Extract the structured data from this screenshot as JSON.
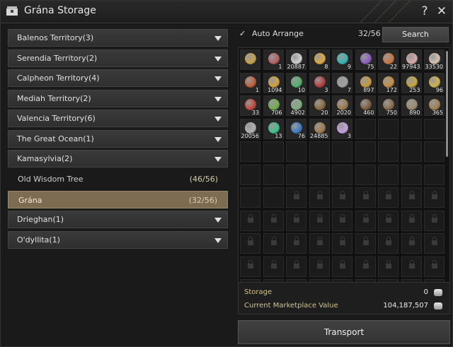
{
  "window": {
    "title": "Grána Storage"
  },
  "territories": [
    {
      "label": "Balenos Territory(3)"
    },
    {
      "label": "Serendia Territory(2)"
    },
    {
      "label": "Calpheon Territory(4)"
    },
    {
      "label": "Mediah Territory(2)"
    },
    {
      "label": "Valencia Territory(6)"
    },
    {
      "label": "The Great Ocean(1)"
    },
    {
      "label": "Kamasylvia(2)"
    }
  ],
  "kamasylvia_subs": [
    {
      "label": "Old Wisdom Tree",
      "count": "(46/56)"
    },
    {
      "label": "Grána",
      "count": "(32/56)"
    }
  ],
  "more_territories": [
    {
      "label": "Drieghan(1)"
    },
    {
      "label": "O'dyllita(1)"
    }
  ],
  "storage_header": {
    "auto_arrange": "Auto Arrange",
    "slots": "32/56",
    "search": "Search"
  },
  "items": [
    {
      "q": "",
      "color": "#c8a24a"
    },
    {
      "q": "1",
      "color": "#b45d5d"
    },
    {
      "q": "20887",
      "color": "#cfcfcf"
    },
    {
      "q": "8",
      "color": "#e0a83a"
    },
    {
      "q": "9",
      "color": "#31b7b7"
    },
    {
      "q": "75",
      "color": "#8a5cc2"
    },
    {
      "q": "22",
      "color": "#d0733a"
    },
    {
      "q": "97943",
      "color": "#d7a6a6"
    },
    {
      "q": "33530",
      "color": "#d6c2b0"
    },
    {
      "q": "1",
      "color": "#c25c37"
    },
    {
      "q": "1094",
      "color": "#d6a13b"
    },
    {
      "q": "10",
      "color": "#4fb06b"
    },
    {
      "q": "3",
      "color": "#b63a3a"
    },
    {
      "q": "7",
      "color": "#a0a0a0"
    },
    {
      "q": "897",
      "color": "#c99a3a"
    },
    {
      "q": "172",
      "color": "#c98d3a"
    },
    {
      "q": "253",
      "color": "#c9a33a"
    },
    {
      "q": "96",
      "color": "#d2b04a"
    },
    {
      "q": "33",
      "color": "#c0463a"
    },
    {
      "q": "706",
      "color": "#6fb04a"
    },
    {
      "q": "4902",
      "color": "#7fb07f"
    },
    {
      "q": "20",
      "color": "#8a6a3a"
    },
    {
      "q": "2020",
      "color": "#9a7a4a"
    },
    {
      "q": "460",
      "color": "#7a5a3a"
    },
    {
      "q": "750",
      "color": "#8a6a4a"
    },
    {
      "q": "890",
      "color": "#9a8a6a"
    },
    {
      "q": "365",
      "color": "#a08050"
    },
    {
      "q": "20056",
      "color": "#b0b0b0"
    },
    {
      "q": "13",
      "color": "#3ac28a"
    },
    {
      "q": "76",
      "color": "#3a7ac2"
    },
    {
      "q": "24885",
      "color": "#a07a4a"
    },
    {
      "q": "3",
      "color": "#c7a0e0"
    }
  ],
  "info": {
    "storage_label": "Storage",
    "storage_value": "0",
    "market_label": "Current Marketplace Value",
    "market_value": "104,187,507"
  },
  "transport": "Transport"
}
